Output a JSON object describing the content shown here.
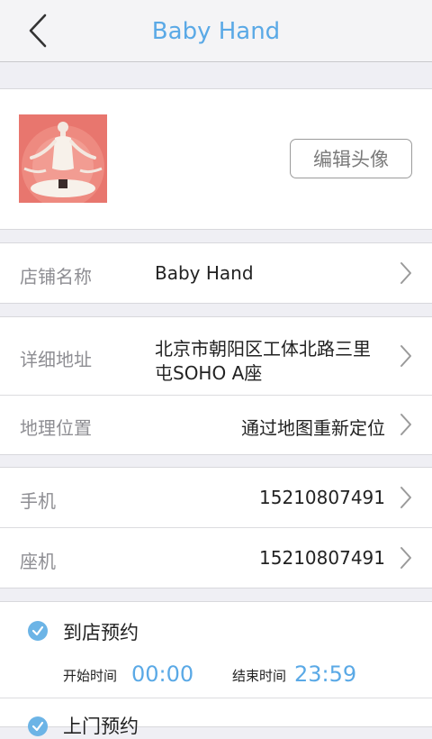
{
  "nav": {
    "title": "Baby Hand"
  },
  "profile": {
    "edit_label": "编辑头像"
  },
  "shop": {
    "name_label": "店铺名称",
    "name_value": "Baby Hand",
    "address_label": "详细地址",
    "address_line1": "北京市朝阳区工体北路三里",
    "address_line2": "屯SOHO A座",
    "location_label": "地理位置",
    "location_value": "通过地图重新定位"
  },
  "contact": {
    "mobile_label": "手机",
    "mobile_value": "15210807491",
    "landline_label": "座机",
    "landline_value": "15210807491"
  },
  "booking": {
    "instore_label": "到店预约",
    "start_label": "开始时间",
    "start_value": "00:00",
    "end_label": "结束时间",
    "end_value": "23:59",
    "home_label": "上门预约"
  },
  "colors": {
    "accent": "#5aa9e6",
    "check": "#6cb4e6",
    "avatar_bg": "#e8766e"
  }
}
